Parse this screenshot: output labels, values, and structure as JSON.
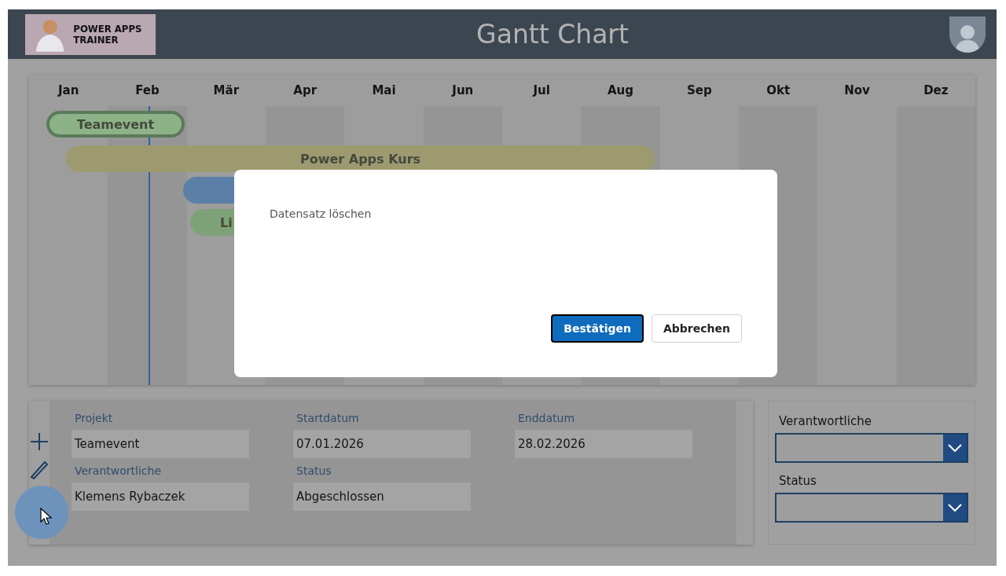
{
  "header": {
    "logo_text": "POWER APPS TRAINER",
    "title": "Gantt Chart"
  },
  "gantt": {
    "months": [
      "Jan",
      "Feb",
      "Mär",
      "Apr",
      "Mai",
      "Jun",
      "Jul",
      "Aug",
      "Sep",
      "Okt",
      "Nov",
      "Dez"
    ],
    "bars": [
      {
        "label": "Teamevent",
        "color": "#8db288",
        "selected": true
      },
      {
        "label": "Power Apps Kurs",
        "color": "#9d9a70",
        "selected": false
      },
      {
        "color": "#5b7fa6",
        "selected": false
      },
      {
        "label": "Li",
        "color": "#7ea278",
        "selected": false
      }
    ]
  },
  "details": {
    "fields": [
      {
        "label": "Projekt",
        "value": "Teamevent"
      },
      {
        "label": "Startdatum",
        "value": "07.01.2026"
      },
      {
        "label": "Enddatum",
        "value": "28.02.2026"
      },
      {
        "label": "Verantwortliche",
        "value": "Klemens Rybaczek"
      },
      {
        "label": "Status",
        "value": "Abgeschlossen"
      }
    ]
  },
  "filters": [
    {
      "label": "Verantwortliche"
    },
    {
      "label": "Status"
    }
  ],
  "dialog": {
    "message": "Datensatz löschen",
    "buttons": [
      {
        "label": "Bestätigen",
        "kind": "primary"
      },
      {
        "label": "Abbrechen",
        "kind": "secondary"
      }
    ]
  }
}
